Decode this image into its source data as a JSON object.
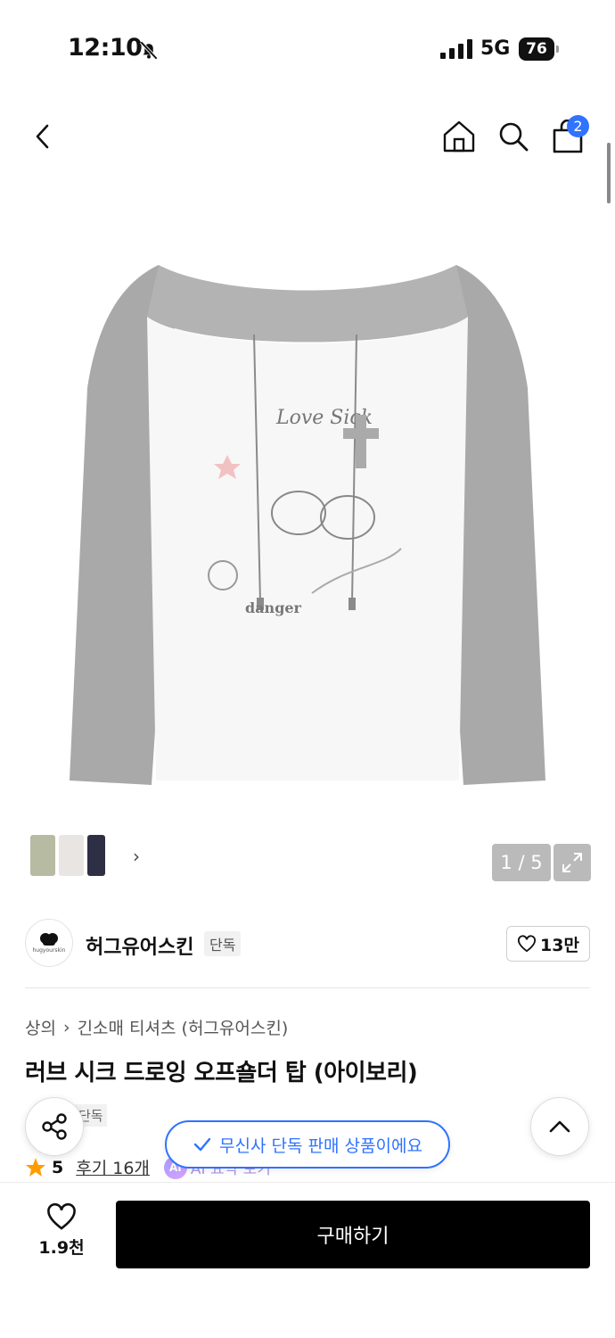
{
  "status_bar": {
    "time": "12:10",
    "network": "5G",
    "battery": "76"
  },
  "nav": {
    "cart_badge": "2"
  },
  "gallery": {
    "counter": "1 / 5"
  },
  "brand": {
    "name": "허그유어스킨",
    "tag": "단독",
    "logo_text": "hugyourskin",
    "likes": "13만"
  },
  "breadcrumb": {
    "category": "상의",
    "sub": "긴소매 티셔츠 (허그유어스킨)"
  },
  "product": {
    "title": "러브 시크 드로잉 오프숄더 탑 (아이보리)",
    "tag": "단독",
    "rating": "5",
    "review_label": "후기 16개",
    "ai_label": "AI 요약 보기"
  },
  "toast": {
    "text": "무신사 단독 판매 상품이에요"
  },
  "bottom": {
    "like_count": "1.9천",
    "buy_label": "구매하기"
  },
  "colors": {
    "accent": "#2f73ff",
    "star": "#ff9d00",
    "buy": "#000000"
  }
}
